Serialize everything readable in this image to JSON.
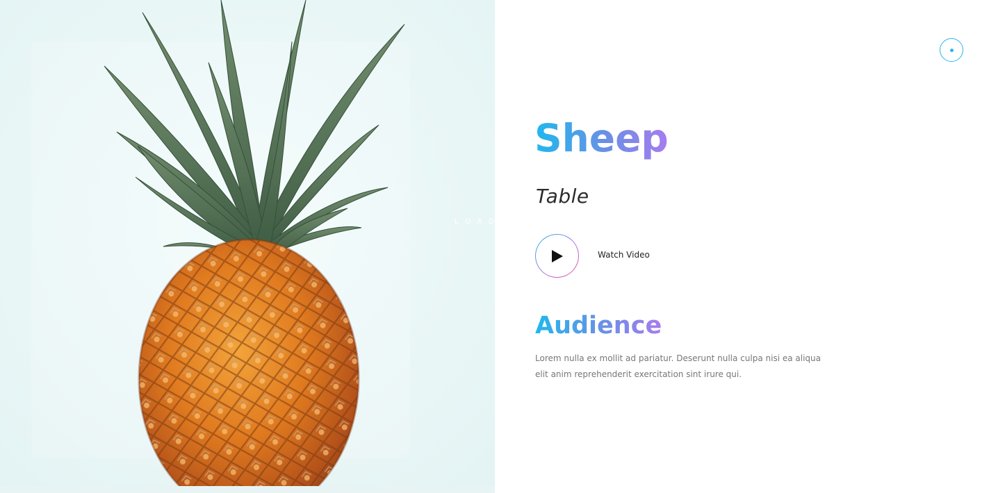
{
  "hero": {
    "image_icon": "pineapple-photo",
    "loading_text": "LOAD"
  },
  "header": {
    "menu_icon": "dot-circle-icon"
  },
  "main": {
    "title": "Sheep",
    "subtitle": "Table",
    "video": {
      "play_icon": "play-icon",
      "label": "Watch Video"
    },
    "section": {
      "heading": "Audience",
      "body": "Lorem nulla ex mollit ad pariatur. Deserunt nulla culpa nisi ea aliqua elit anim reprehenderit exercitation sint irure qui."
    }
  },
  "colors": {
    "accent_start": "#1fb8ec",
    "accent_end": "#a77cee",
    "play_ring_end": "#f0489a",
    "menu_ring": "#29b6e8",
    "body_text": "#777777",
    "subtitle_text": "#2b2b2b",
    "hero_background": "#eaf6f6"
  }
}
